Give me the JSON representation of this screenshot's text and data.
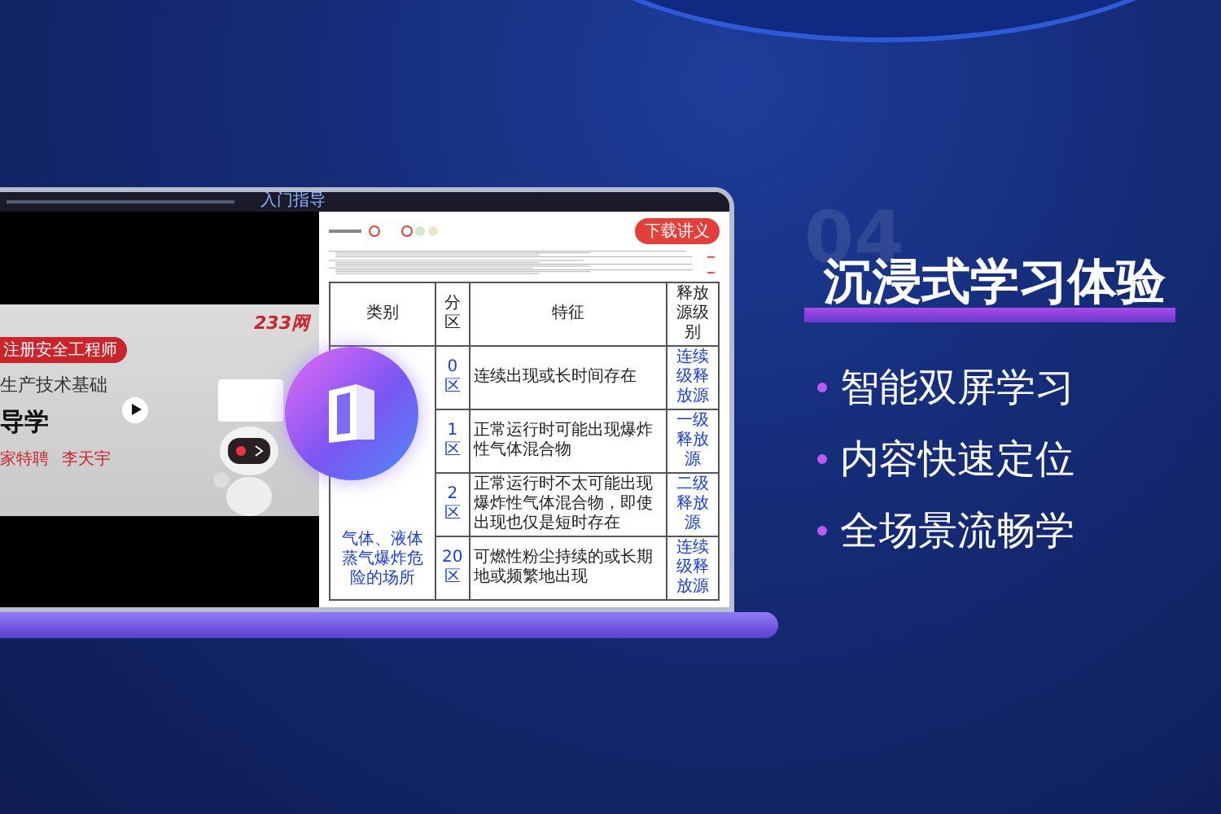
{
  "top_bar": {
    "label": "入门指导"
  },
  "video": {
    "logo": "233网",
    "badge": "注册安全工程师",
    "subject": "生产技术基础",
    "title": "导学",
    "teacher_role": "家特聘",
    "teacher_name": "李天宇"
  },
  "document": {
    "download_button": "下载讲义",
    "table": {
      "columns": [
        "类别",
        "分区",
        "特征",
        "释放源级别"
      ],
      "rows": [
        {
          "category": "气体、液体蒸气爆炸危险的场所",
          "zone": "0区",
          "feature": "连续出现或长时间存在",
          "level": "连续级释放源"
        },
        {
          "category": "",
          "zone": "1区",
          "feature": "正常运行时可能出现爆炸性气体混合物",
          "level": "一级释放源"
        },
        {
          "category": "",
          "zone": "2区",
          "feature": "正常运行时不太可能出现爆炸性气体混合物，即使出现也仅是短时存在",
          "level": "二级释放源"
        },
        {
          "category": "",
          "zone": "20区",
          "feature": "可燃性粉尘持续的或长期地或频繁地出现",
          "level": "连续级释放源"
        }
      ]
    }
  },
  "feature": {
    "number": "04",
    "title": "沉浸式学习体验",
    "bullets": [
      "智能双屏学习",
      "内容快速定位",
      "全场景流畅学"
    ]
  }
}
